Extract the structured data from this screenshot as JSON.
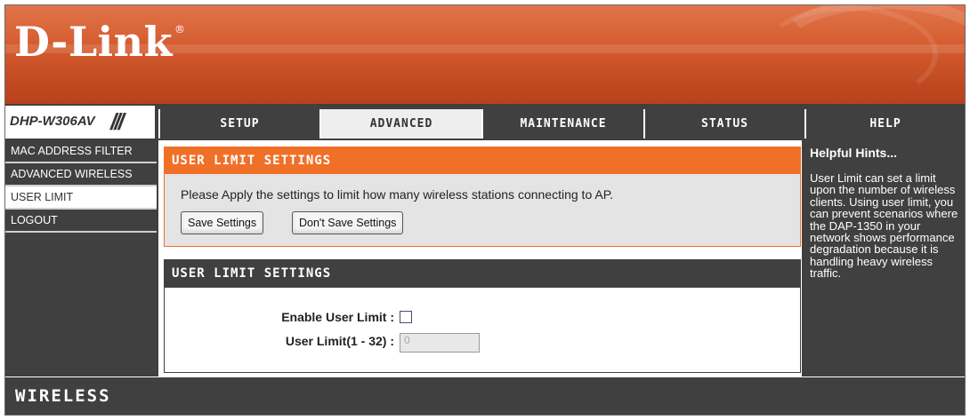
{
  "brand": {
    "logo_text": "D-Link",
    "logo_mark": "®",
    "model": "DHP-W306AV",
    "model_slashes": "///"
  },
  "nav": {
    "tabs": [
      {
        "label": "SETUP",
        "active": false
      },
      {
        "label": "ADVANCED",
        "active": true
      },
      {
        "label": "MAINTENANCE",
        "active": false
      },
      {
        "label": "STATUS",
        "active": false
      }
    ],
    "help": "HELP"
  },
  "sidebar": {
    "items": [
      {
        "label": "MAC ADDRESS FILTER",
        "active": false
      },
      {
        "label": "ADVANCED WIRELESS",
        "active": false
      },
      {
        "label": "USER LIMIT",
        "active": true
      },
      {
        "label": "LOGOUT",
        "active": false
      }
    ]
  },
  "section_top": {
    "title": "USER LIMIT SETTINGS",
    "description": "Please Apply the settings to limit how many wireless stations connecting to AP.",
    "save_label": "Save Settings",
    "dont_save_label": "Don't Save Settings"
  },
  "section_main": {
    "title": "USER LIMIT SETTINGS",
    "enable_label": "Enable User Limit :",
    "enable_checked": false,
    "limit_label": "User Limit(1 - 32) :",
    "limit_value": "0"
  },
  "hints": {
    "title": "Helpful Hints...",
    "body": "User Limit can set a limit upon the number of wireless clients. Using user limit, you can prevent scenarios where the DAP-1350 in your network shows performance degradation because it is handling heavy wireless traffic."
  },
  "footer": {
    "label": "WIRELESS"
  },
  "colors": {
    "accent": "#f07028",
    "dark": "#404040",
    "banner": "#d25a2c"
  }
}
